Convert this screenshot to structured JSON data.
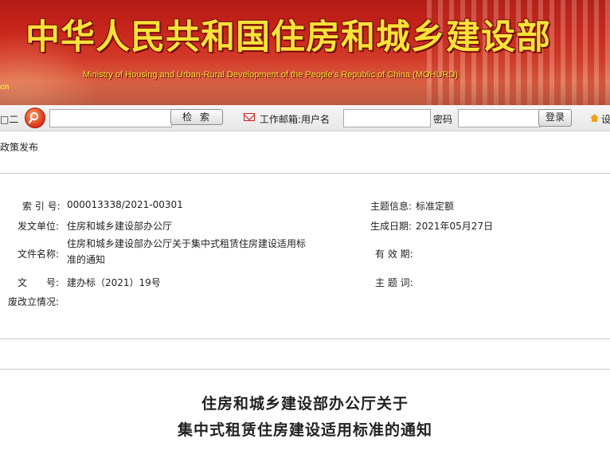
{
  "header": {
    "title": "中华人民共和国住房和城乡建设部",
    "subtitle": "Ministry of Housing and Urban-Rural Development of the People's Republic of China (MOHURD)",
    "left_fragment": "cn"
  },
  "toolbar": {
    "nav_fragment": "□二",
    "search_button": "检索",
    "mail_label": "工作邮箱:用户名",
    "password_label": "密码",
    "login_button": "登录",
    "home_fragment": "设"
  },
  "breadcrumb": "政策发布",
  "info": {
    "index_label": "索 引 号:",
    "index_value": "000013338/2021-00301",
    "topic_label": "主题信息:",
    "topic_value": "标准定额",
    "issuer_label": "发文单位:",
    "issuer_value": "住房和城乡建设部办公厅",
    "date_label": "生成日期:",
    "date_value": "2021年05月27日",
    "filename_label": "文件名称:",
    "filename_value": "住房和城乡建设部办公厅关于集中式租赁住房建设适用标准的通知",
    "validity_label": "有 效 期:",
    "docno_label": "文　　号:",
    "docno_value": "建办标（2021）19号",
    "keywords_label": "主 题 词:",
    "status_label": "废改立情况:"
  },
  "document": {
    "title_line1": "住房和城乡建设部办公厅关于",
    "title_line2": "集中式租赁住房建设适用标准的通知"
  },
  "icons": {
    "search": "search-icon",
    "mail": "mail-icon",
    "home": "home-icon"
  },
  "colors": {
    "banner_red": "#c8261c",
    "title_yellow": "#f7e23a",
    "mail_red": "#c62020"
  }
}
